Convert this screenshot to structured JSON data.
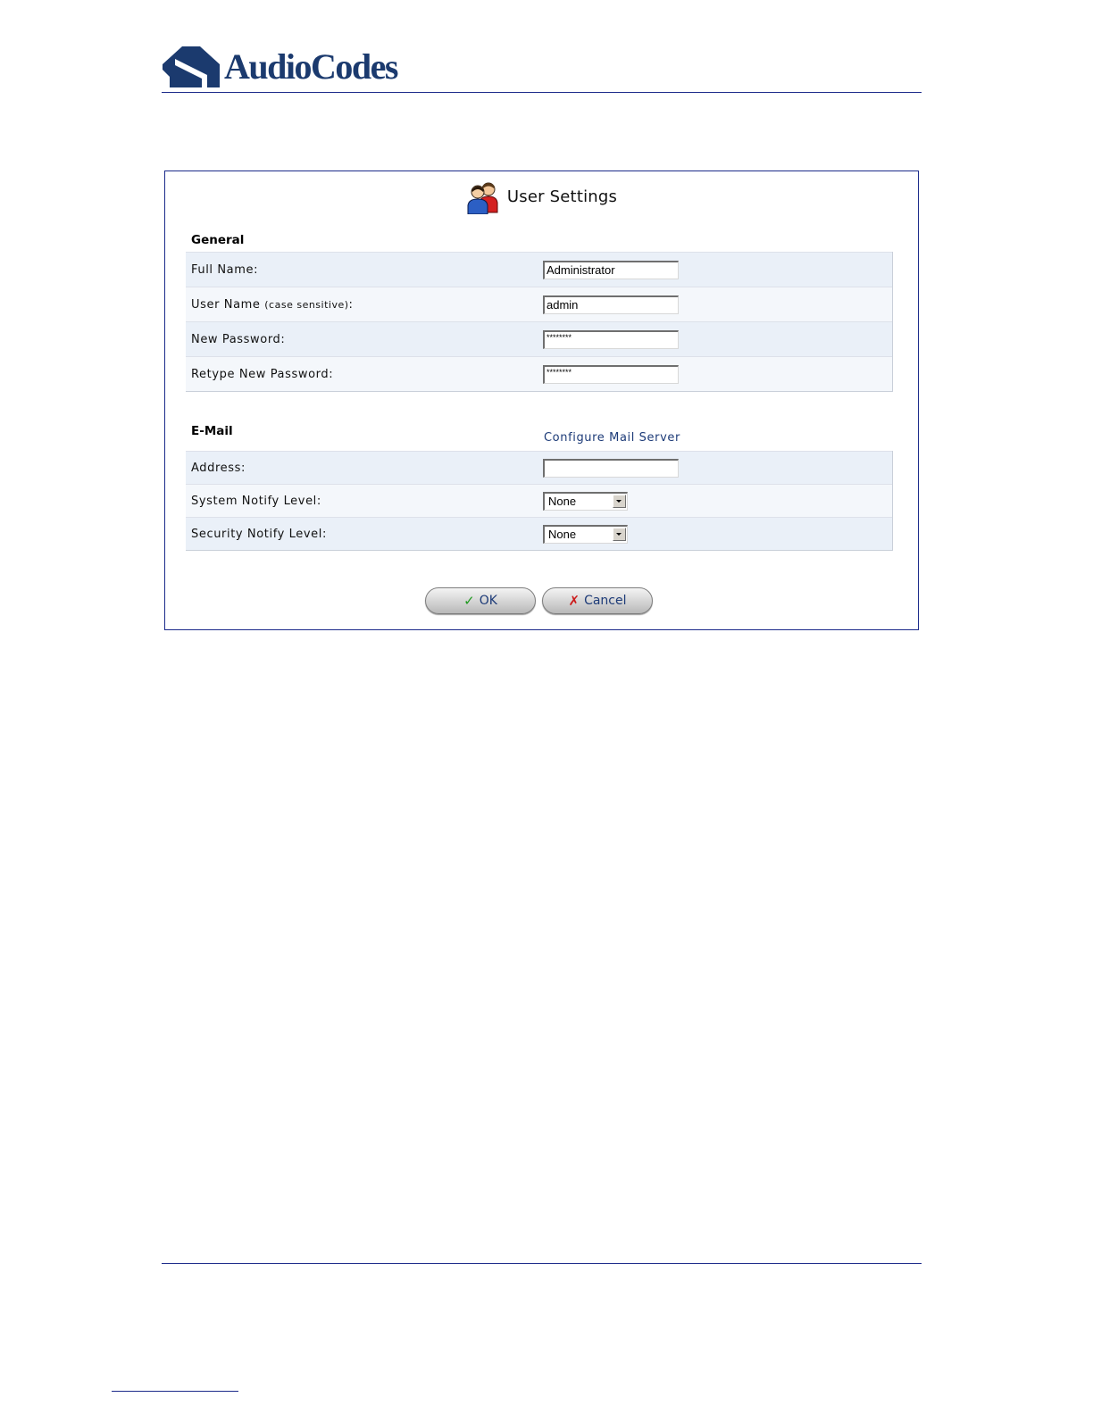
{
  "brand": {
    "logo_text": "AudioCodes",
    "color": "#1b3a6e"
  },
  "dialog": {
    "title": "User Settings",
    "title_icon": "users-icon"
  },
  "general": {
    "heading": "General",
    "full_name_label": "Full Name:",
    "full_name_value": "Administrator",
    "user_name_label": "User Name",
    "user_name_hint": "(case sensitive)",
    "user_name_colon": ":",
    "user_name_value": "admin",
    "new_password_label": "New Password:",
    "new_password_value": "********",
    "retype_password_label": "Retype New Password:",
    "retype_password_value": "********"
  },
  "email": {
    "heading": "E-Mail",
    "configure_link": "Configure Mail Server",
    "address_label": "Address:",
    "address_value": "",
    "system_notify_label": "System Notify Level:",
    "system_notify_value": "None",
    "security_notify_label": "Security Notify Level:",
    "security_notify_value": "None"
  },
  "buttons": {
    "ok_label": "OK",
    "ok_icon": "check-icon",
    "cancel_label": "Cancel",
    "cancel_icon": "x-icon"
  },
  "colors": {
    "row_shade": "#eaf0f8",
    "link": "#1d3b78",
    "frame_border": "#1b2a8a"
  }
}
